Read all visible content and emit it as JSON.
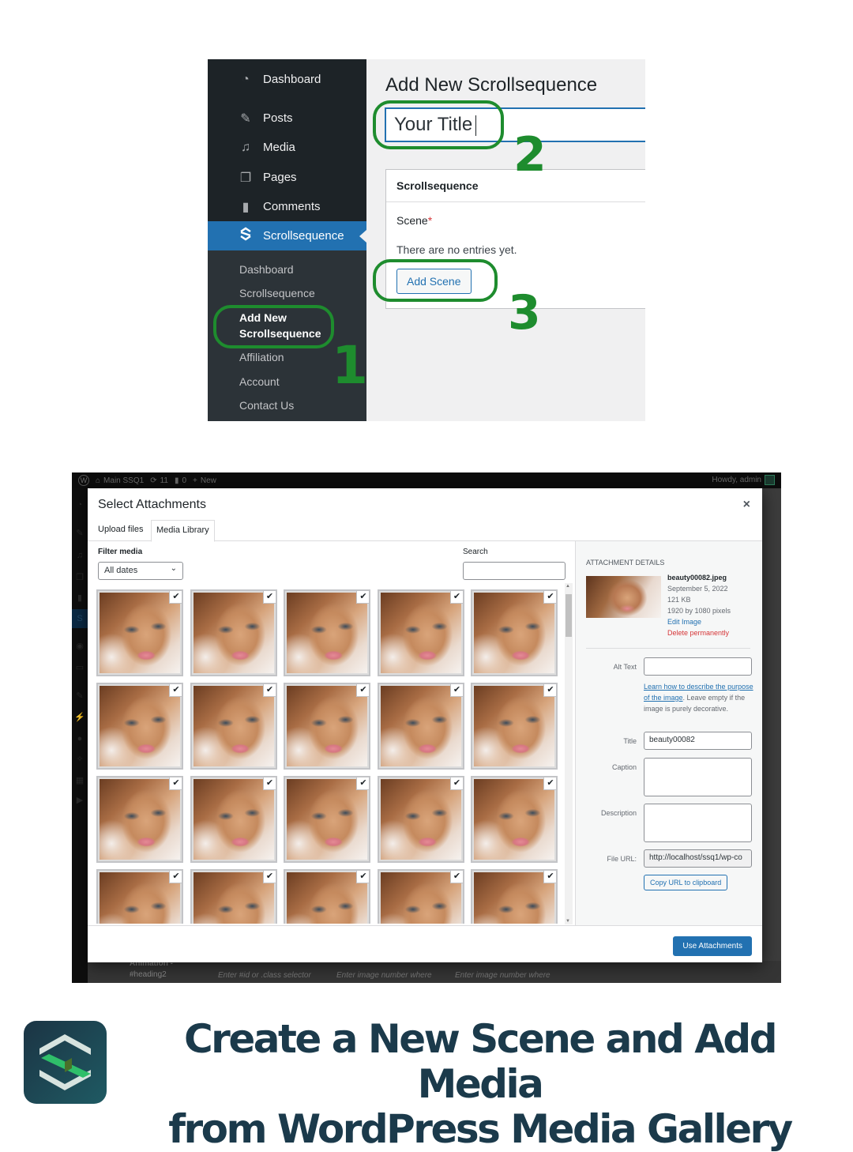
{
  "panel1": {
    "sidebar": {
      "menu": [
        {
          "label": "Dashboard",
          "icon": "dashboard-icon",
          "glyph": "◔"
        },
        {
          "label": "Posts",
          "icon": "pin-icon",
          "glyph": "✎"
        },
        {
          "label": "Media",
          "icon": "media-icon",
          "glyph": "♫"
        },
        {
          "label": "Pages",
          "icon": "pages-icon",
          "glyph": "❐"
        },
        {
          "label": "Comments",
          "icon": "comment-icon",
          "glyph": "▮"
        },
        {
          "label": "Scrollsequence",
          "icon": "scrollsequence-icon",
          "glyph": "S",
          "active": true
        }
      ],
      "submenu": [
        {
          "label": "Dashboard"
        },
        {
          "label": "Scrollsequence"
        },
        {
          "label": "Add New Scrollsequence",
          "current": true
        },
        {
          "label": "Affiliation"
        },
        {
          "label": "Account"
        },
        {
          "label": "Contact Us"
        }
      ]
    },
    "page_title": "Add New Scrollsequence",
    "title_input_value": "Your Title",
    "metabox": {
      "header": "Scrollsequence",
      "field_label": "Scene",
      "required_mark": "*",
      "empty_text": "There are no entries yet.",
      "add_button": "Add Scene"
    },
    "steps": [
      "1",
      "2",
      "3"
    ],
    "callout_color": "#1e8c2e"
  },
  "panel2": {
    "admin_bar": {
      "site_name": "Main SSQ1",
      "updates_count": "11",
      "comments_count": "0",
      "new_label": "New",
      "greeting": "Howdy, admin"
    },
    "modal": {
      "title": "Select Attachments",
      "close_glyph": "×",
      "tabs": [
        {
          "label": "Upload files",
          "active": false
        },
        {
          "label": "Media Library",
          "active": true
        }
      ],
      "filter_label": "Filter media",
      "filter_value": "All dates",
      "search_label": "Search",
      "search_value": "",
      "grid": {
        "columns": 5,
        "visible_rows": 4,
        "all_selected": true,
        "check_glyph": "✔"
      },
      "details": {
        "heading": "Attachment Details",
        "filename": "beauty00082.jpeg",
        "date": "September 5, 2022",
        "filesize": "121 KB",
        "dimensions": "1920 by 1080 pixels",
        "edit_link": "Edit Image",
        "delete_link": "Delete permanently",
        "alt_text_label": "Alt Text",
        "alt_text_value": "",
        "alt_help_link": "Learn how to describe the purpose of the image",
        "alt_help_text": ". Leave empty if the image is purely decorative.",
        "title_label": "Title",
        "title_value": "beauty00082",
        "caption_label": "Caption",
        "caption_value": "",
        "description_label": "Description",
        "description_value": "",
        "file_url_label": "File URL:",
        "file_url_value": "http://localhost/ssq1/wp-co",
        "copy_button": "Copy URL to clipboard"
      },
      "use_button": "Use Attachments"
    },
    "background": {
      "row_label_1": "Animation -",
      "row_label_2": "#heading2",
      "placeholder_1": "Enter #id or .class selector",
      "placeholder_2": "Enter image number where",
      "placeholder_3": "Enter image number where"
    }
  },
  "footer": {
    "headline_line1": "Create a New Scene and Add Media",
    "headline_line2": "from WordPress Media Gallery",
    "brand_colors": {
      "dark": "#1b3a4b",
      "green": "#2fbf6a",
      "light": "#d7e3df"
    }
  }
}
